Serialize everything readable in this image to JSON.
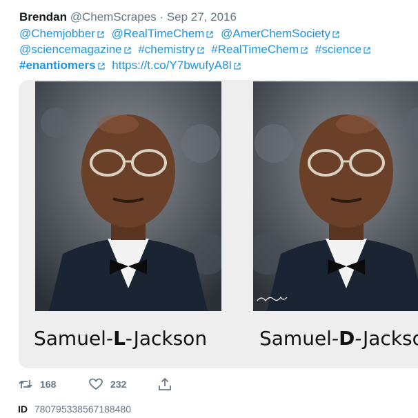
{
  "tweet": {
    "author": "Brendan",
    "handle": "@ChemScrapes",
    "separator": "·",
    "date": "Sep 27, 2016",
    "links": {
      "chemjobber": "@Chemjobber",
      "realtimechem_user": "@RealTimeChem",
      "amerchemsociety": "@AmerChemSociety",
      "sciencemagazine": "@sciencemagazine",
      "hashtag_chemistry": "#chemistry",
      "hashtag_realtimechem": "#RealTimeChem",
      "hashtag_science": "#science",
      "hashtag_enantiomers": "#enantiomers",
      "url": "https://t.co/Y7bwufyA8I"
    }
  },
  "media": {
    "left_caption": {
      "prefix": "Samuel-",
      "bold": "L",
      "suffix": "-Jackson"
    },
    "right_caption": {
      "prefix": "Samuel-",
      "bold": "D",
      "suffix": "-Jackson"
    }
  },
  "actions": {
    "retweet_count": "168",
    "like_count": "232",
    "icons": [
      "retweet-icon",
      "heart-icon",
      "share-icon"
    ]
  },
  "id_line": {
    "label": "ID",
    "value": "780795338567188480"
  },
  "colors": {
    "link": "#1b95e0",
    "muted": "#657786",
    "card_bg": "#eeeeee"
  }
}
